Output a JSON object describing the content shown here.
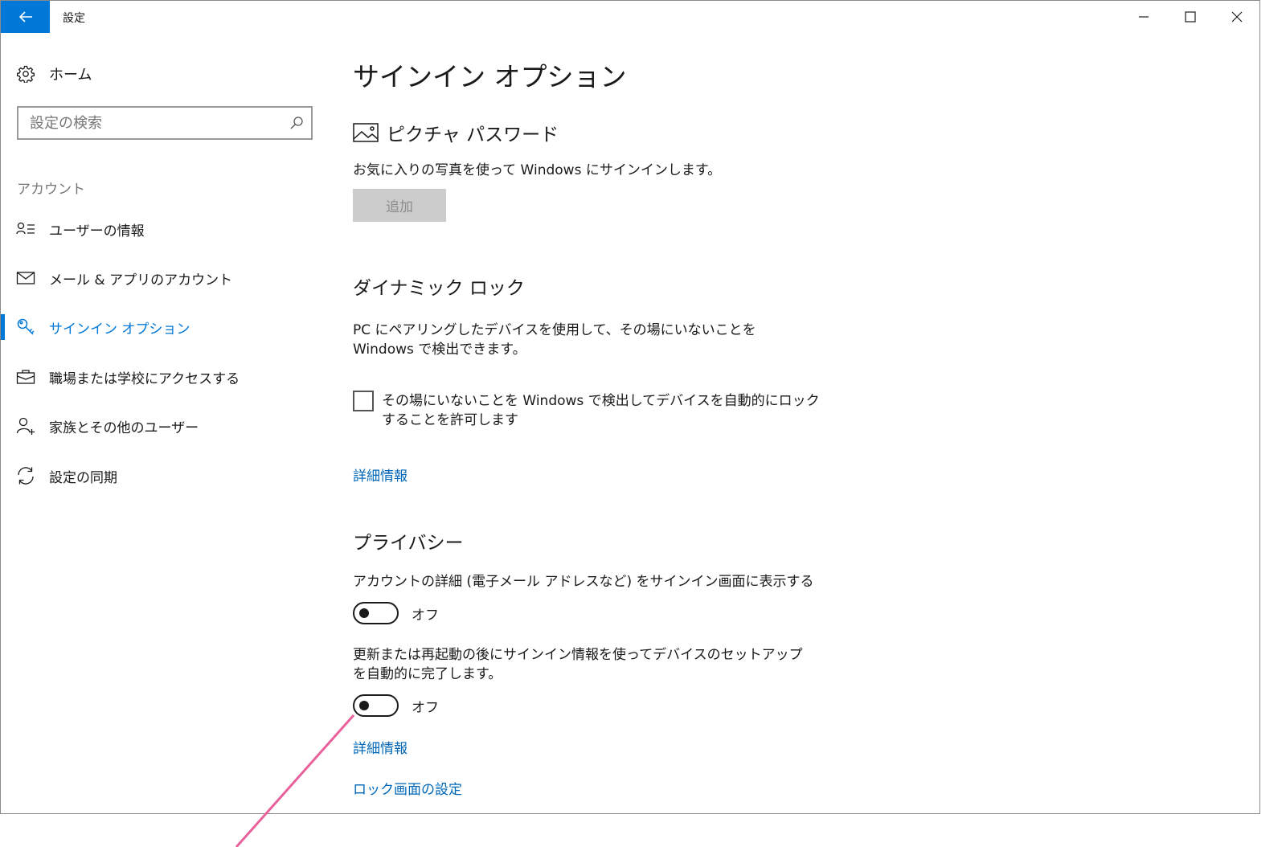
{
  "window": {
    "title": "設定",
    "icons": {
      "back": "back-arrow-icon",
      "minimize": "minimize-icon",
      "maximize": "maximize-icon",
      "close": "close-icon"
    }
  },
  "colors": {
    "accent": "#0078d7",
    "link": "#0067b8",
    "annotation": "#e8619b",
    "button_disabled_bg": "#cccccc"
  },
  "sidebar": {
    "home_label": "ホーム",
    "search_placeholder": "設定の検索",
    "section_label": "アカウント",
    "items": [
      {
        "label": "ユーザーの情報",
        "icon": "user-info-icon",
        "active": false
      },
      {
        "label": "メール & アプリのアカウント",
        "icon": "mail-icon",
        "active": false
      },
      {
        "label": "サインイン オプション",
        "icon": "key-icon",
        "active": true
      },
      {
        "label": "職場または学校にアクセスする",
        "icon": "briefcase-icon",
        "active": false
      },
      {
        "label": "家族とその他のユーザー",
        "icon": "add-person-icon",
        "active": false
      },
      {
        "label": "設定の同期",
        "icon": "sync-icon",
        "active": false
      }
    ]
  },
  "main": {
    "title": "サインイン オプション",
    "picture_password": {
      "heading": "ピクチャ パスワード",
      "description": "お気に入りの写真を使って Windows にサインインします。",
      "add_button": "追加"
    },
    "dynamic_lock": {
      "heading": "ダイナミック ロック",
      "description": "PC にペアリングしたデバイスを使用して、その場にいないことを Windows で検出できます。",
      "checkbox_label": "その場にいないことを Windows で検出してデバイスを自動的にロックすることを許可します",
      "checkbox_checked": false,
      "more_info": "詳細情報"
    },
    "privacy": {
      "heading": "プライバシー",
      "setting1_label": "アカウントの詳細 (電子メール アドレスなど) をサインイン画面に表示する",
      "setting1_state": "オフ",
      "setting2_label": "更新または再起動の後にサインイン情報を使ってデバイスのセットアップを自動的に完了します。",
      "setting2_state": "オフ",
      "more_info": "詳細情報",
      "lock_screen_link": "ロック画面の設定"
    }
  }
}
